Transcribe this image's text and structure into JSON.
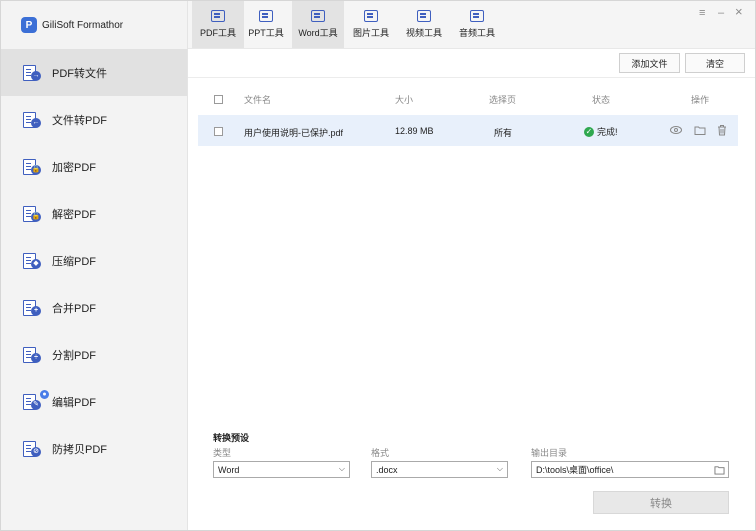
{
  "app": {
    "name": "GiliSoft Formathor",
    "logo_letter": "P"
  },
  "sidebar": {
    "items": [
      {
        "label": "PDF转文件",
        "glyph": "→",
        "active": true
      },
      {
        "label": "文件转PDF",
        "glyph": "←"
      },
      {
        "label": "加密PDF",
        "glyph": "🔒"
      },
      {
        "label": "解密PDF",
        "glyph": "🔓"
      },
      {
        "label": "压缩PDF",
        "glyph": "◆"
      },
      {
        "label": "合并PDF",
        "glyph": "+"
      },
      {
        "label": "分割PDF",
        "glyph": "÷"
      },
      {
        "label": "编辑PDF",
        "glyph": "✎"
      },
      {
        "label": "防拷贝PDF",
        "glyph": "⊘"
      }
    ]
  },
  "topbar": {
    "tabs": [
      {
        "label": "PDF工具",
        "active": true
      },
      {
        "label": "PPT工具"
      },
      {
        "label": "Word工具",
        "active": true
      },
      {
        "label": "图片工具"
      },
      {
        "label": "视频工具"
      },
      {
        "label": "音频工具"
      }
    ],
    "window_controls": {
      "menu": "≡",
      "minimize": "–",
      "close": "×"
    }
  },
  "toolbar": {
    "add_file": "添加文件",
    "clear": "清空"
  },
  "table": {
    "columns": [
      "文件名",
      "大小",
      "选择页",
      "状态",
      "操作"
    ],
    "rows": [
      {
        "filename": "用户使用说明-已保护.pdf",
        "size": "12.89 MB",
        "pages": "所有",
        "status": "完成!"
      }
    ]
  },
  "preset": {
    "title": "转换预设",
    "type_label": "类型",
    "type_value": "Word",
    "format_label": "格式",
    "format_value": ".docx",
    "output_label": "输出目录",
    "output_value": "D:\\tools\\桌面\\office\\"
  },
  "convert_button": "转换",
  "colors": {
    "accent": "#3f5fbf",
    "row_highlight": "#e8f0fb",
    "success": "#2fa84f"
  }
}
